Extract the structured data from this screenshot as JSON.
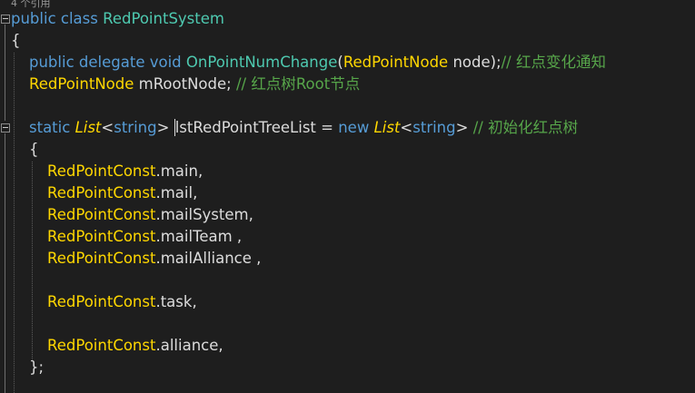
{
  "editor": {
    "codelens": "4 个引用",
    "lines": {
      "class_decl": {
        "kw1": "public",
        "kw2": "class",
        "name": "RedPointSystem"
      },
      "open_brace1": "{",
      "delegate_decl": {
        "kw1": "public",
        "kw2": "delegate",
        "kw3": "void",
        "name": "OnPointNumChange",
        "paren_open": "(",
        "param_type": "RedPointNode",
        "param_name": " node);",
        "comment": "// 红点变化通知"
      },
      "field_decl": {
        "type": "RedPointNode",
        "name": " mRootNode;",
        "comment": "// 红点树Root节点"
      },
      "list_decl": {
        "kw": "static",
        "type1": "List",
        "lt1": "<",
        "targ1": "string",
        "gt1": ">",
        "name_first": "l",
        "name_rest": "stRedPointTreeList",
        "eq": " = ",
        "kw_new": "new",
        "type2": "List",
        "lt2": "<",
        "targ2": "string",
        "gt2": ">",
        "comment": "// 初始化红点树"
      },
      "open_brace2": "{",
      "items": [
        {
          "cls": "RedPointConst",
          "member": ".main,"
        },
        {
          "cls": "RedPointConst",
          "member": ".mail,"
        },
        {
          "cls": "RedPointConst",
          "member": ".mailSystem,"
        },
        {
          "cls": "RedPointConst",
          "member": ".mailTeam ,"
        },
        {
          "cls": "RedPointConst",
          "member": ".mailAlliance ,"
        },
        {
          "cls": "RedPointConst",
          "member": ".task,"
        },
        {
          "cls": "RedPointConst",
          "member": ".alliance,"
        }
      ],
      "close_brace2": "};"
    }
  },
  "colors": {
    "background": "#1e1e1e",
    "keyword": "#569cd6",
    "type": "#4ec9b0",
    "class_name": "#ffd700",
    "method": "#dcdcaa",
    "plain": "#dcdcdc",
    "comment": "#57a64a"
  }
}
